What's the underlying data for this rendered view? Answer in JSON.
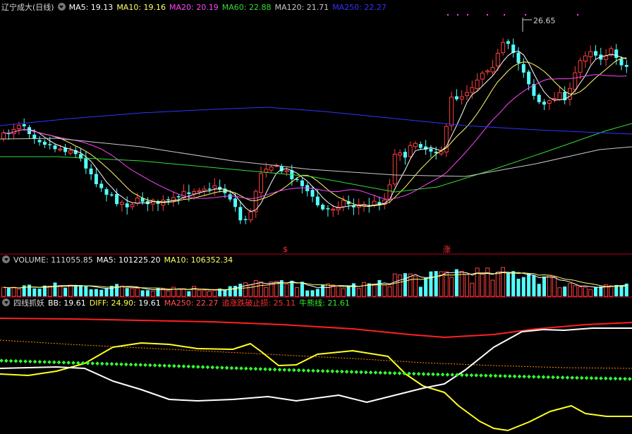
{
  "header": {
    "stock_title": "辽宁成大(日线)",
    "ma5": "MA5: 19.13",
    "ma10": "MA10: 19.16",
    "ma20": "MA20: 20.19",
    "ma60": "MA60: 22.88",
    "ma120": "MA120: 21.71",
    "ma250": "MA250: 22.27"
  },
  "price_panel": {
    "high_marker": "26.65",
    "signal_sell": "$",
    "signal_up": "涨"
  },
  "volume_panel": {
    "volume": "VOLUME: 111055.85",
    "ma5": "MA5: 101225.20",
    "ma10": "MA10: 106352.34"
  },
  "indicator_panel": {
    "name": "四线抓妖",
    "bb": "BB: 19.61",
    "diff": "DIFF: 24.90",
    "diff2": ": 19.61",
    "ma250": "MA250: 22.27",
    "stop": "追涨跌破止损: 25.11",
    "bull": "牛熊线: 21.61"
  },
  "colors": {
    "up": "#ff4040",
    "down": "#54ffff",
    "ma5": "#ffffff",
    "ma10": "#ffff66",
    "ma20": "#ff44ff",
    "ma60": "#33dd33",
    "ma120": "#c8c8c8",
    "ma250": "#3333ff",
    "panel_border": "#b4001e"
  },
  "chart_data": [
    {
      "type": "candlestick",
      "series": [
        {
          "name": "MA5",
          "current": 19.13
        },
        {
          "name": "MA10",
          "current": 19.16
        },
        {
          "name": "MA20",
          "current": 20.19
        },
        {
          "name": "MA60",
          "current": 22.88
        },
        {
          "name": "MA120",
          "current": 21.71
        },
        {
          "name": "MA250",
          "current": 22.27
        }
      ],
      "max_marker": 26.65,
      "ylim": [
        16.8,
        27.4
      ]
    },
    {
      "type": "bar",
      "series": [
        {
          "name": "VOLUME",
          "current": 111055.85
        },
        {
          "name": "MA5",
          "current": 101225.2
        },
        {
          "name": "MA10",
          "current": 106352.34
        }
      ]
    },
    {
      "type": "line",
      "series": [
        {
          "name": "BB",
          "current": 19.61
        },
        {
          "name": "DIFF",
          "current": 24.9
        },
        {
          "name": "MA250",
          "current": 22.27
        },
        {
          "name": "追涨跌破止损",
          "current": 25.11
        },
        {
          "name": "牛熊线",
          "current": 21.61
        }
      ]
    }
  ]
}
